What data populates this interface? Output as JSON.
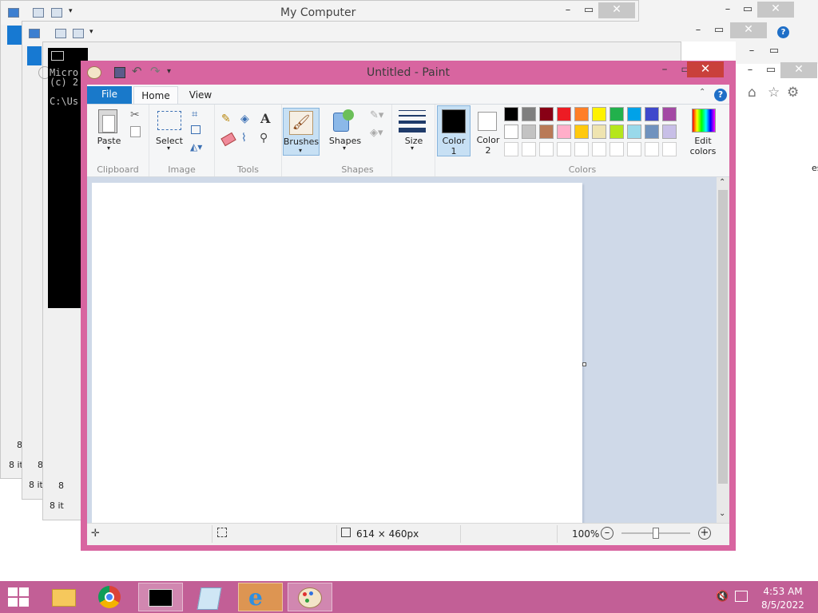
{
  "background_windows": {
    "my_computer_title": "My Computer",
    "items_status_1": "8 it",
    "items_status_2": "8 it",
    "items_status_3": "8 it",
    "side_digit_1": "8",
    "side_digit_2": "8",
    "side_digit_3": "8",
    "right_edge_text": "es"
  },
  "console": {
    "line1": "Micro",
    "line2": "(c) 2",
    "line3": "C:\\Us"
  },
  "paint": {
    "title": "Untitled - Paint",
    "tabs": {
      "file": "File",
      "home": "Home",
      "view": "View"
    },
    "help": "?",
    "clipboard": {
      "paste": "Paste",
      "group": "Clipboard"
    },
    "image": {
      "select": "Select",
      "group": "Image"
    },
    "tools": {
      "group": "Tools"
    },
    "brushes": {
      "label": "Brushes"
    },
    "shapes": {
      "label": "Shapes",
      "group": "Shapes"
    },
    "size": {
      "label": "Size"
    },
    "color1": {
      "line1": "Color",
      "line2": "1",
      "value": "#000000"
    },
    "color2": {
      "line1": "Color",
      "line2": "2",
      "value": "#ffffff"
    },
    "colors_group": "Colors",
    "edit_colors": {
      "line1": "Edit",
      "line2": "colors"
    },
    "palette_row1": [
      "#000000",
      "#7f7f7f",
      "#880015",
      "#ed1c24",
      "#ff7f27",
      "#fff200",
      "#22b14c",
      "#00a2e8",
      "#3f48cc",
      "#a349a4"
    ],
    "palette_row2": [
      "#ffffff",
      "#c3c3c3",
      "#b97a57",
      "#ffaec9",
      "#ffc90e",
      "#efe4b0",
      "#b5e61d",
      "#99d9ea",
      "#7092be",
      "#c8bfe7"
    ],
    "palette_row3": [
      "#ffffff",
      "#ffffff",
      "#ffffff",
      "#ffffff",
      "#ffffff",
      "#ffffff",
      "#ffffff",
      "#ffffff",
      "#ffffff",
      "#ffffff"
    ],
    "status": {
      "canvas_size": "614 × 460px",
      "zoom": "100%",
      "zoom_fraction": 0.5
    }
  },
  "taskbar": {
    "time": "4:53 AM",
    "date": "8/5/2022"
  },
  "colors": {
    "paint_frame": "#d865a0",
    "taskbar": "#c25f96",
    "file_tab": "#1979ca"
  }
}
